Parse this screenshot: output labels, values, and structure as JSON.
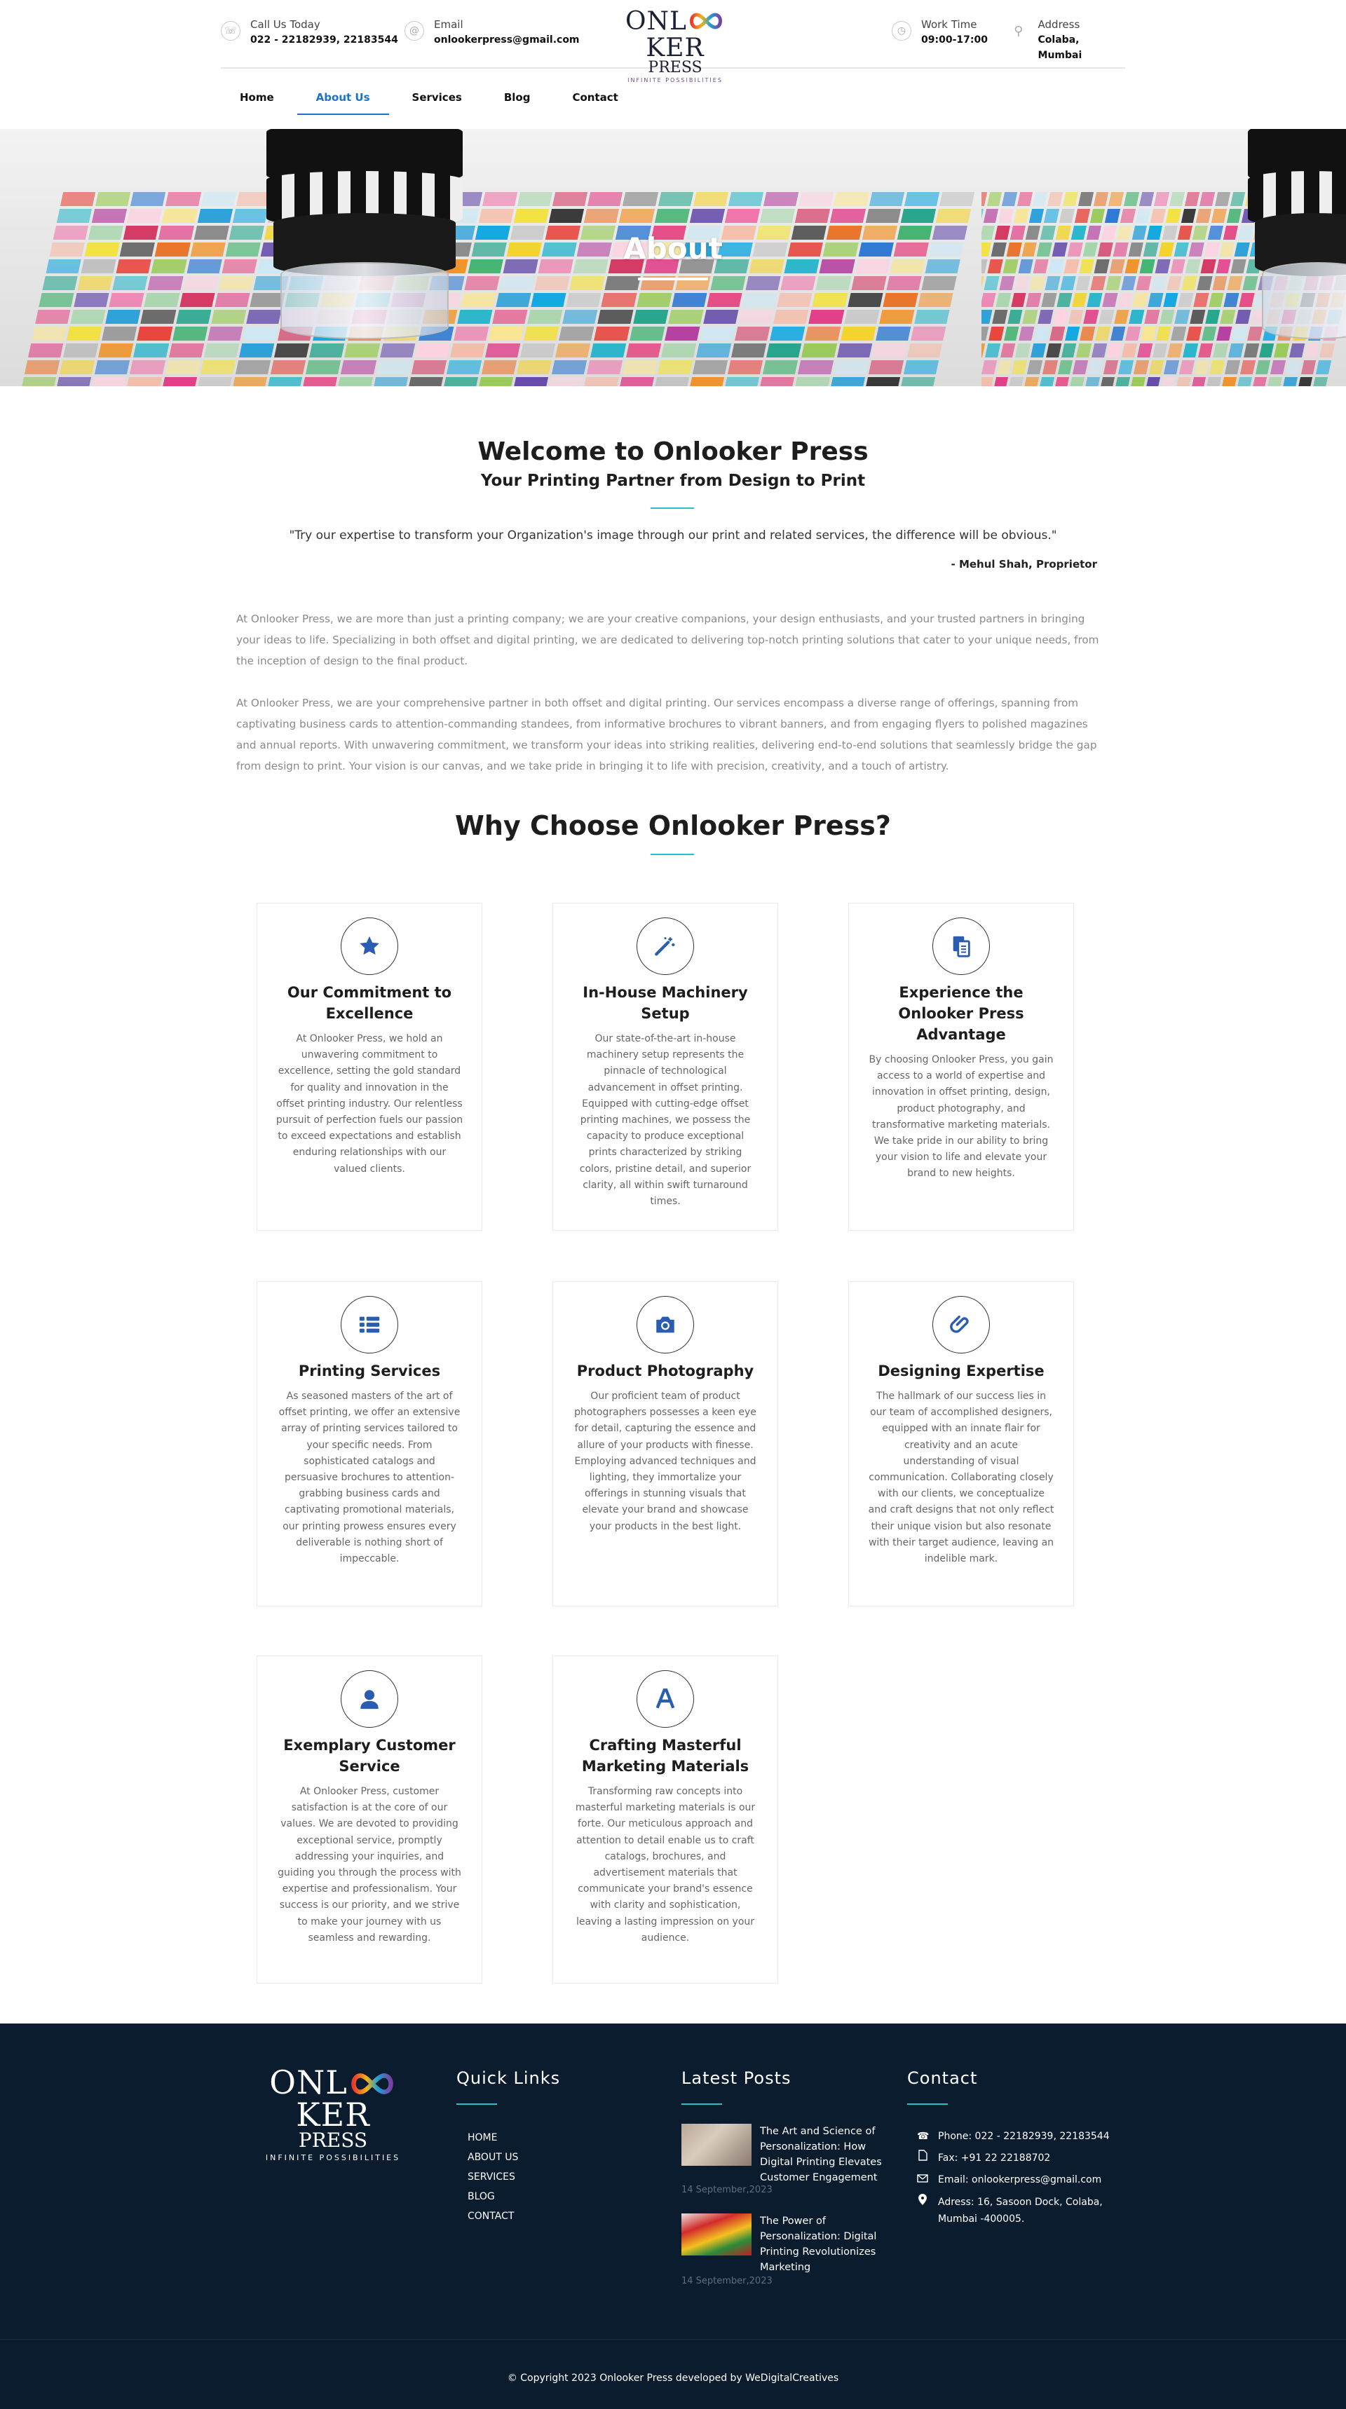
{
  "header": {
    "call": {
      "label": "Call Us Today",
      "value": "022 - 22182939, 22183544",
      "icon": "phone-icon"
    },
    "email": {
      "label": "Email",
      "value": "onlookerpress@gmail.com",
      "icon": "at-icon"
    },
    "work": {
      "label": "Work Time",
      "value": "09:00-17:00",
      "icon": "clock-icon"
    },
    "address": {
      "label": "Address",
      "value": "Colaba, Mumbai",
      "icon": "map-pin-icon"
    },
    "logo": {
      "line1_a": "ONL",
      "line1_b": "KER",
      "line2": "PRESS",
      "tagline": "INFINITE POSSIBILITIES"
    }
  },
  "nav": [
    "Home",
    "About Us",
    "Services",
    "Blog",
    "Contact"
  ],
  "nav_active": "About Us",
  "hero": {
    "title": "About"
  },
  "intro": {
    "title": "Welcome to Onlooker Press",
    "subtitle": "Your Printing Partner from Design to Print",
    "quote": "\"Try our expertise to transform your Organization's image through our print and related services, the difference will be obvious.\"",
    "author": "- Mehul Shah, Proprietor",
    "p1": "At Onlooker Press, we are more than just a printing company; we are your creative companions, your design enthusiasts, and your trusted partners in bringing your ideas to life. Specializing in both offset and digital printing, we are dedicated to delivering top-notch printing solutions that cater to your unique needs, from the inception of design to the final product.",
    "p2": "At Onlooker Press, we are your comprehensive partner in both offset and digital printing. Our services encompass a diverse range of offerings, spanning from captivating business cards to attention-commanding standees, from informative brochures to vibrant banners, and from engaging flyers to polished magazines and annual reports. With unwavering commitment, we transform your ideas into striking realities, delivering end-to-end solutions that seamlessly bridge the gap from design to print. Your vision is our canvas, and we take pride in bringing it to life with precision, creativity, and a touch of artistry."
  },
  "why": {
    "title": "Why Choose Onlooker Press?",
    "cards": [
      {
        "title": "Our Commitment to Excellence",
        "icon": "star-icon",
        "text": "At Onlooker Press, we hold an unwavering commitment to excellence, setting the gold standard for quality and innovation in the offset printing industry. Our relentless pursuit of perfection fuels our passion to exceed expectations and establish enduring relationships with our valued clients."
      },
      {
        "title": "In-House Machinery Setup",
        "icon": "magic-wand-icon",
        "text": "Our state-of-the-art in-house machinery setup represents the pinnacle of technological advancement in offset printing. Equipped with cutting-edge offset printing machines, we possess the capacity to produce exceptional prints characterized by striking colors, pristine detail, and superior clarity, all within swift turnaround times."
      },
      {
        "title": "Experience the Onlooker Press Advantage",
        "icon": "copy-icon",
        "text": "By choosing Onlooker Press, you gain access to a world of expertise and innovation in offset printing, design, product photography, and transformative marketing materials. We take pride in our ability to bring your vision to life and elevate your brand to new heights."
      },
      {
        "title": "Printing Services",
        "icon": "list-icon",
        "text": "As seasoned masters of the art of offset printing, we offer an extensive array of printing services tailored to your specific needs. From sophisticated catalogs and persuasive brochures to attention-grabbing business cards and captivating promotional materials, our printing prowess ensures every deliverable is nothing short of impeccable."
      },
      {
        "title": "Product Photography",
        "icon": "camera-icon",
        "text": "Our proficient team of product photographers possesses a keen eye for detail, capturing the essence and allure of your products with finesse. Employing advanced techniques and lighting, they immortalize your offerings in stunning visuals that elevate your brand and showcase your products in the best light."
      },
      {
        "title": "Designing Expertise",
        "icon": "paperclip-icon",
        "text": "The hallmark of our success lies in our team of accomplished designers, equipped with an innate flair for creativity and an acute understanding of visual communication. Collaborating closely with our clients, we conceptualize and craft designs that not only reflect their unique vision but also resonate with their target audience, leaving an indelible mark."
      },
      {
        "title": "Exemplary Customer Service",
        "icon": "user-icon",
        "text": "At Onlooker Press, customer satisfaction is at the core of our values. We are devoted to providing exceptional service, promptly addressing your inquiries, and guiding you through the process with expertise and professionalism. Your success is our priority, and we strive to make your journey with us seamless and rewarding."
      },
      {
        "title": "Crafting Masterful Marketing Materials",
        "icon": "font-icon",
        "text": "Transforming raw concepts into masterful marketing materials is our forte. Our meticulous approach and attention to detail enable us to craft catalogs, brochures, and advertisement materials that communicate your brand's essence with clarity and sophistication, leaving a lasting impression on your audience."
      }
    ]
  },
  "footer": {
    "logo": {
      "line1_a": "ONL",
      "line1_b": "KER",
      "line2": "PRESS",
      "tagline": "INFINITE POSSIBILITIES"
    },
    "quick_title": "Quick Links",
    "quick_links": [
      "HOME",
      "ABOUT US",
      "SERVICES",
      "BLOG",
      "CONTACT"
    ],
    "posts_title": "Latest Posts",
    "posts": [
      {
        "title": "The Art and Science of Personalization: How Digital Printing Elevates Customer Engagement",
        "date": "14 September,2023"
      },
      {
        "title": "The Power of Personalization: Digital Printing Revolutionizes Marketing",
        "date": "14 September,2023"
      }
    ],
    "contact_title": "Contact",
    "contact": [
      {
        "icon": "phone-icon",
        "text": "Phone: 022 - 22182939, 22183544"
      },
      {
        "icon": "file-icon",
        "text": "Fax: +91 22 22188702"
      },
      {
        "icon": "envelope-icon",
        "text": "Email: onlookerpress@gmail.com"
      },
      {
        "icon": "map-marker-icon",
        "text": "Adress: 16, Sasoon Dock, Colaba, Mumbai -400005."
      }
    ],
    "copyright": "© Copyright 2023 Onlooker Press developed by WeDigitalCreatives"
  },
  "colors": {
    "accent": "#1a73c8",
    "teal": "#27c2c9",
    "icon_blue": "#2a5db0",
    "footer_bg": "#0a1c2e"
  }
}
